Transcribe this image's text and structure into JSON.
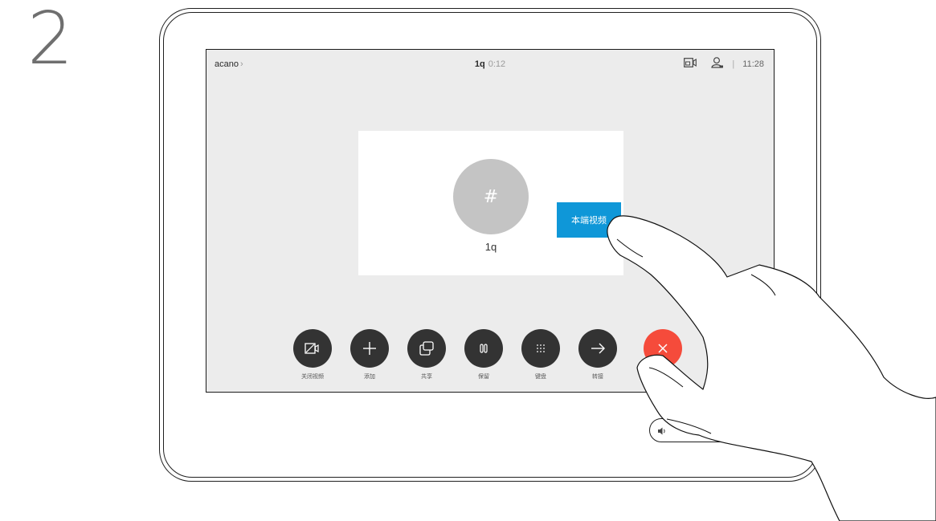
{
  "step": {
    "number": "2"
  },
  "topbar": {
    "breadcrumb": "acano",
    "call_name": "1q",
    "call_time": "0:12",
    "clock": "11:28",
    "separator": "|",
    "icons": [
      "selfview-icon",
      "person-icon"
    ]
  },
  "call_card": {
    "avatar_text": "#",
    "name": "1q"
  },
  "selfview_button": {
    "label": "本端视频"
  },
  "controls": [
    {
      "icon": "video-off-icon",
      "label": "关闭视频"
    },
    {
      "icon": "plus-icon",
      "label": "添加"
    },
    {
      "icon": "share-icon",
      "label": "共享"
    },
    {
      "icon": "pause-icon",
      "label": "保留"
    },
    {
      "icon": "keypad-icon",
      "label": "键盘"
    },
    {
      "icon": "arrow-right-icon",
      "label": "转接"
    },
    {
      "icon": "close-icon",
      "label": ""
    }
  ],
  "colors": {
    "screen_bg": "#ececec",
    "control_bg": "#333333",
    "end_call": "#f54b3b",
    "selfview_button": "#0f97d8",
    "avatar": "#c4c4c4"
  }
}
